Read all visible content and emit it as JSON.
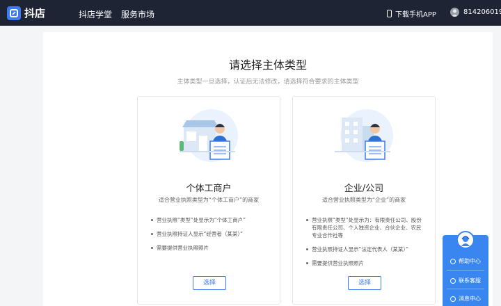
{
  "header": {
    "logo_text": "抖店",
    "nav": [
      "抖店学堂",
      "服务市场"
    ],
    "download_label": "下载手机APP",
    "account_id": "814206019"
  },
  "main": {
    "title": "请选择主体类型",
    "subtitle": "主体类型一旦选择，认证后无法修改，请选择符合要求的主体类型",
    "cards": [
      {
        "title": "个体工商户",
        "desc": "适合营业执照类型为“个体工商户”的商家",
        "bullets": [
          "营业执照“类型”处显示为“个体工商户”",
          "营业执照持证人显示“经营者（某某）”",
          "需要提供营业执照照片"
        ],
        "button": "选择"
      },
      {
        "title": "企业/公司",
        "desc": "适合营业执照类型为“企业”的商家",
        "bullets": [
          "营业执照“类型”处显示为：有限责任公司、股份有限责任公司、个人独资企业、合伙企业、农民专业合作社等",
          "营业执照持证人显示“法定代表人（某某）”",
          "需要提供营业执照照片"
        ],
        "button": "选择"
      }
    ]
  },
  "side_widget": {
    "items": [
      "帮助中心",
      "联系客服",
      "消息中心"
    ]
  },
  "colors": {
    "topbar": "#1e2434",
    "accent": "#3a7bf5"
  }
}
